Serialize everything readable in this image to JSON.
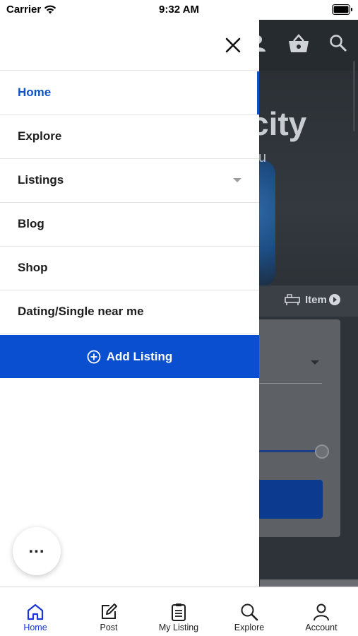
{
  "status_bar": {
    "carrier": "Carrier",
    "time": "9:32 AM",
    "icons": [
      "wifi-icon",
      "battery-icon"
    ]
  },
  "background_app": {
    "hero_title_fragment": "city",
    "hero_subtitle_fragment": "u",
    "tab_fragment": "Item",
    "header_icons": [
      "user-icon",
      "basket-icon",
      "search-icon"
    ]
  },
  "drawer": {
    "close_icon": "close-icon",
    "menu": [
      {
        "label": "Home",
        "active": true
      },
      {
        "label": "Explore",
        "active": false
      },
      {
        "label": "Listings",
        "active": false,
        "has_dropdown": true
      },
      {
        "label": "Blog",
        "active": false
      },
      {
        "label": "Shop",
        "active": false
      },
      {
        "label": "Dating/Single near me",
        "active": false
      }
    ],
    "add_listing": {
      "label": "Add Listing",
      "icon": "plus-circle-icon"
    },
    "accent_color": "#0a4fcf"
  },
  "fab": {
    "label": "...",
    "icon": "more-icon"
  },
  "tabbar": {
    "tabs": [
      {
        "label": "Home",
        "icon": "home-icon",
        "active": true
      },
      {
        "label": "Post",
        "icon": "edit-icon",
        "active": false
      },
      {
        "label": "My Listing",
        "icon": "clipboard-icon",
        "active": false
      },
      {
        "label": "Explore",
        "icon": "search-icon",
        "active": false
      },
      {
        "label": "Account",
        "icon": "account-icon",
        "active": false
      }
    ],
    "active_color": "#1b34d6"
  }
}
